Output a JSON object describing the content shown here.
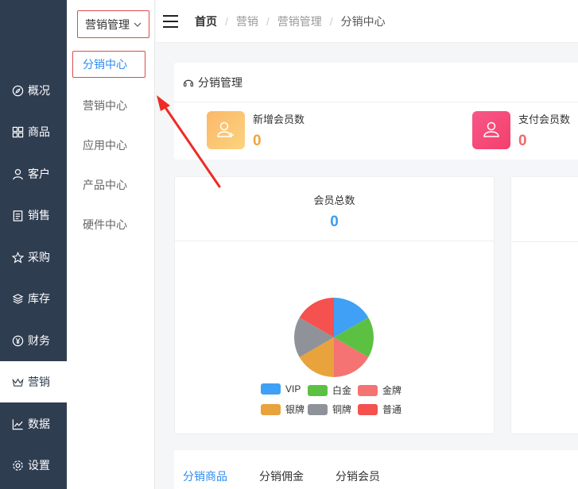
{
  "sidebar": {
    "items": [
      {
        "label": "概况",
        "icon": "compass-icon"
      },
      {
        "label": "商品",
        "icon": "grid-icon"
      },
      {
        "label": "客户",
        "icon": "user-icon"
      },
      {
        "label": "销售",
        "icon": "clipboard-icon"
      },
      {
        "label": "采购",
        "icon": "star-icon"
      },
      {
        "label": "库存",
        "icon": "layers-icon"
      },
      {
        "label": "财务",
        "icon": "yen-icon"
      },
      {
        "label": "营销",
        "icon": "crown-icon"
      },
      {
        "label": "数据",
        "icon": "chart-line-icon"
      },
      {
        "label": "设置",
        "icon": "gear-icon"
      }
    ],
    "active_label": "营销"
  },
  "submenu": {
    "title": "营销管理",
    "items": [
      "分销中心",
      "营销中心",
      "应用中心",
      "产品中心",
      "硬件中心"
    ],
    "active": "分销中心"
  },
  "topbar": {
    "breadcrumb": [
      "首页",
      "营销",
      "营销管理",
      "分销中心"
    ]
  },
  "manage": {
    "title": "分销管理",
    "stats": [
      {
        "label": "新增会员数",
        "value": "0",
        "color": "#f0a63a"
      },
      {
        "label": "支付会员数",
        "value": "0",
        "color": "#f06a6a"
      }
    ]
  },
  "members": {
    "label": "会员总数",
    "count": "0"
  },
  "chart_data": {
    "type": "pie",
    "categories": [
      "VIP",
      "白金",
      "金牌",
      "银牌",
      "铜牌",
      "普通"
    ],
    "values": [
      1,
      1,
      1,
      1,
      1,
      1
    ],
    "colors": [
      "#3fa0f5",
      "#5cc142",
      "#f57373",
      "#e8a33d",
      "#8f9399",
      "#f4514f"
    ],
    "legend_position": "bottom"
  },
  "tabs": [
    "分销商品",
    "分销佣金",
    "分销会员"
  ],
  "active_tab": "分销商品"
}
